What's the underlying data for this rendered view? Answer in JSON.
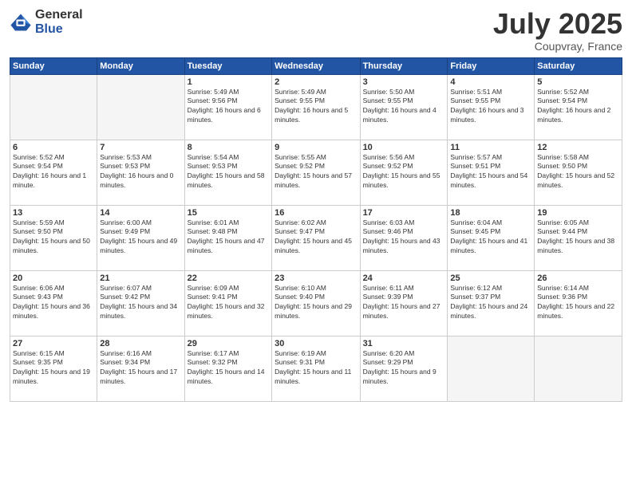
{
  "logo": {
    "general": "General",
    "blue": "Blue"
  },
  "title": {
    "month_year": "July 2025",
    "location": "Coupvray, France"
  },
  "weekdays": [
    "Sunday",
    "Monday",
    "Tuesday",
    "Wednesday",
    "Thursday",
    "Friday",
    "Saturday"
  ],
  "weeks": [
    [
      {
        "day": "",
        "sunrise": "",
        "sunset": "",
        "daylight": "",
        "empty": true
      },
      {
        "day": "",
        "sunrise": "",
        "sunset": "",
        "daylight": "",
        "empty": true
      },
      {
        "day": "1",
        "sunrise": "Sunrise: 5:49 AM",
        "sunset": "Sunset: 9:56 PM",
        "daylight": "Daylight: 16 hours and 6 minutes."
      },
      {
        "day": "2",
        "sunrise": "Sunrise: 5:49 AM",
        "sunset": "Sunset: 9:55 PM",
        "daylight": "Daylight: 16 hours and 5 minutes."
      },
      {
        "day": "3",
        "sunrise": "Sunrise: 5:50 AM",
        "sunset": "Sunset: 9:55 PM",
        "daylight": "Daylight: 16 hours and 4 minutes."
      },
      {
        "day": "4",
        "sunrise": "Sunrise: 5:51 AM",
        "sunset": "Sunset: 9:55 PM",
        "daylight": "Daylight: 16 hours and 3 minutes."
      },
      {
        "day": "5",
        "sunrise": "Sunrise: 5:52 AM",
        "sunset": "Sunset: 9:54 PM",
        "daylight": "Daylight: 16 hours and 2 minutes."
      }
    ],
    [
      {
        "day": "6",
        "sunrise": "Sunrise: 5:52 AM",
        "sunset": "Sunset: 9:54 PM",
        "daylight": "Daylight: 16 hours and 1 minute."
      },
      {
        "day": "7",
        "sunrise": "Sunrise: 5:53 AM",
        "sunset": "Sunset: 9:53 PM",
        "daylight": "Daylight: 16 hours and 0 minutes."
      },
      {
        "day": "8",
        "sunrise": "Sunrise: 5:54 AM",
        "sunset": "Sunset: 9:53 PM",
        "daylight": "Daylight: 15 hours and 58 minutes."
      },
      {
        "day": "9",
        "sunrise": "Sunrise: 5:55 AM",
        "sunset": "Sunset: 9:52 PM",
        "daylight": "Daylight: 15 hours and 57 minutes."
      },
      {
        "day": "10",
        "sunrise": "Sunrise: 5:56 AM",
        "sunset": "Sunset: 9:52 PM",
        "daylight": "Daylight: 15 hours and 55 minutes."
      },
      {
        "day": "11",
        "sunrise": "Sunrise: 5:57 AM",
        "sunset": "Sunset: 9:51 PM",
        "daylight": "Daylight: 15 hours and 54 minutes."
      },
      {
        "day": "12",
        "sunrise": "Sunrise: 5:58 AM",
        "sunset": "Sunset: 9:50 PM",
        "daylight": "Daylight: 15 hours and 52 minutes."
      }
    ],
    [
      {
        "day": "13",
        "sunrise": "Sunrise: 5:59 AM",
        "sunset": "Sunset: 9:50 PM",
        "daylight": "Daylight: 15 hours and 50 minutes."
      },
      {
        "day": "14",
        "sunrise": "Sunrise: 6:00 AM",
        "sunset": "Sunset: 9:49 PM",
        "daylight": "Daylight: 15 hours and 49 minutes."
      },
      {
        "day": "15",
        "sunrise": "Sunrise: 6:01 AM",
        "sunset": "Sunset: 9:48 PM",
        "daylight": "Daylight: 15 hours and 47 minutes."
      },
      {
        "day": "16",
        "sunrise": "Sunrise: 6:02 AM",
        "sunset": "Sunset: 9:47 PM",
        "daylight": "Daylight: 15 hours and 45 minutes."
      },
      {
        "day": "17",
        "sunrise": "Sunrise: 6:03 AM",
        "sunset": "Sunset: 9:46 PM",
        "daylight": "Daylight: 15 hours and 43 minutes."
      },
      {
        "day": "18",
        "sunrise": "Sunrise: 6:04 AM",
        "sunset": "Sunset: 9:45 PM",
        "daylight": "Daylight: 15 hours and 41 minutes."
      },
      {
        "day": "19",
        "sunrise": "Sunrise: 6:05 AM",
        "sunset": "Sunset: 9:44 PM",
        "daylight": "Daylight: 15 hours and 38 minutes."
      }
    ],
    [
      {
        "day": "20",
        "sunrise": "Sunrise: 6:06 AM",
        "sunset": "Sunset: 9:43 PM",
        "daylight": "Daylight: 15 hours and 36 minutes."
      },
      {
        "day": "21",
        "sunrise": "Sunrise: 6:07 AM",
        "sunset": "Sunset: 9:42 PM",
        "daylight": "Daylight: 15 hours and 34 minutes."
      },
      {
        "day": "22",
        "sunrise": "Sunrise: 6:09 AM",
        "sunset": "Sunset: 9:41 PM",
        "daylight": "Daylight: 15 hours and 32 minutes."
      },
      {
        "day": "23",
        "sunrise": "Sunrise: 6:10 AM",
        "sunset": "Sunset: 9:40 PM",
        "daylight": "Daylight: 15 hours and 29 minutes."
      },
      {
        "day": "24",
        "sunrise": "Sunrise: 6:11 AM",
        "sunset": "Sunset: 9:39 PM",
        "daylight": "Daylight: 15 hours and 27 minutes."
      },
      {
        "day": "25",
        "sunrise": "Sunrise: 6:12 AM",
        "sunset": "Sunset: 9:37 PM",
        "daylight": "Daylight: 15 hours and 24 minutes."
      },
      {
        "day": "26",
        "sunrise": "Sunrise: 6:14 AM",
        "sunset": "Sunset: 9:36 PM",
        "daylight": "Daylight: 15 hours and 22 minutes."
      }
    ],
    [
      {
        "day": "27",
        "sunrise": "Sunrise: 6:15 AM",
        "sunset": "Sunset: 9:35 PM",
        "daylight": "Daylight: 15 hours and 19 minutes."
      },
      {
        "day": "28",
        "sunrise": "Sunrise: 6:16 AM",
        "sunset": "Sunset: 9:34 PM",
        "daylight": "Daylight: 15 hours and 17 minutes."
      },
      {
        "day": "29",
        "sunrise": "Sunrise: 6:17 AM",
        "sunset": "Sunset: 9:32 PM",
        "daylight": "Daylight: 15 hours and 14 minutes."
      },
      {
        "day": "30",
        "sunrise": "Sunrise: 6:19 AM",
        "sunset": "Sunset: 9:31 PM",
        "daylight": "Daylight: 15 hours and 11 minutes."
      },
      {
        "day": "31",
        "sunrise": "Sunrise: 6:20 AM",
        "sunset": "Sunset: 9:29 PM",
        "daylight": "Daylight: 15 hours and 9 minutes."
      },
      {
        "day": "",
        "sunrise": "",
        "sunset": "",
        "daylight": "",
        "empty": true
      },
      {
        "day": "",
        "sunrise": "",
        "sunset": "",
        "daylight": "",
        "empty": true
      }
    ]
  ]
}
